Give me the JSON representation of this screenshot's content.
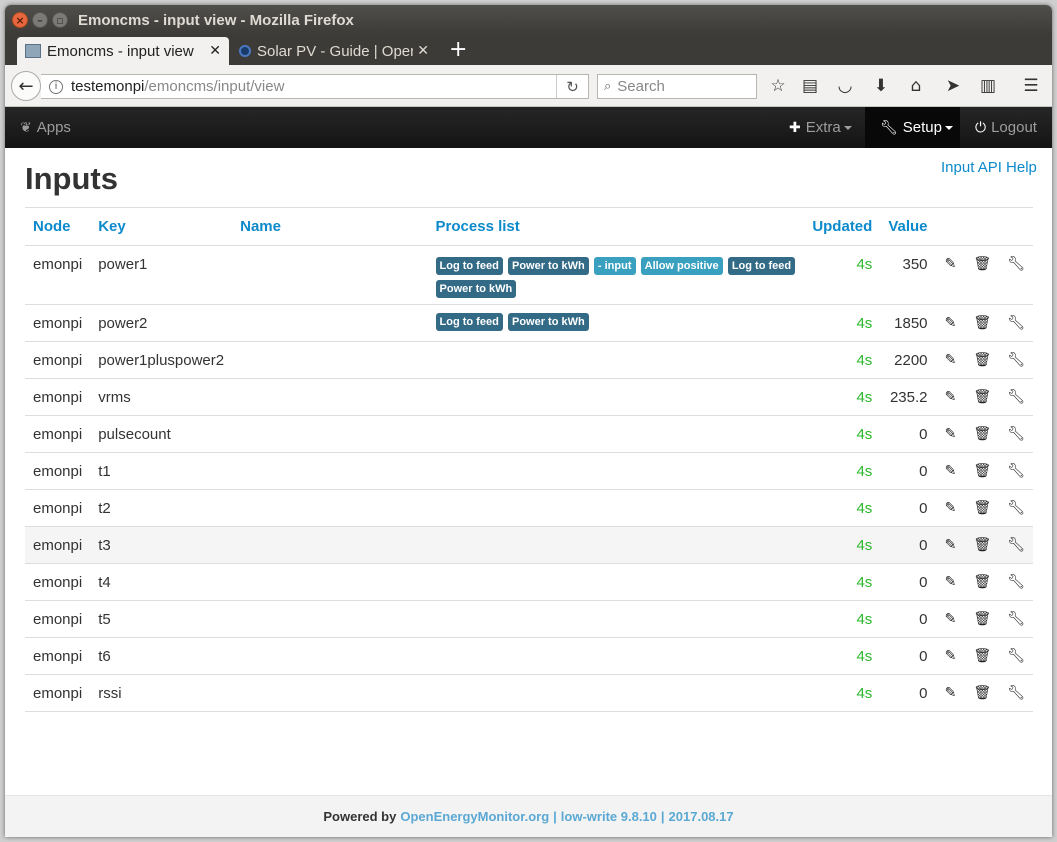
{
  "window": {
    "title": "Emoncms - input view - Mozilla Firefox"
  },
  "tabs": [
    {
      "label": "Emoncms - input view",
      "close": "✕"
    },
    {
      "label": "Solar PV - Guide | OpenEnergyMonitor",
      "close": "✕"
    }
  ],
  "toolbar": {
    "url_host": "testemonpi",
    "url_path": "/emoncms/input/view",
    "search_placeholder": "Search"
  },
  "appnav": {
    "apps": "Apps",
    "extra": "Extra",
    "setup": "Setup",
    "logout": "Logout"
  },
  "page": {
    "title": "Inputs",
    "api_help": "Input API Help"
  },
  "table": {
    "headers": {
      "node": "Node",
      "key": "Key",
      "name": "Name",
      "process": "Process list",
      "updated": "Updated",
      "value": "Value"
    },
    "rows": [
      {
        "node": "emonpi",
        "key": "power1",
        "name": "",
        "process": [
          {
            "label": "Log to feed",
            "style": "dark"
          },
          {
            "label": "Power to kWh",
            "style": "dark"
          },
          {
            "label": "- input",
            "style": "light"
          },
          {
            "label": "Allow positive",
            "style": "light"
          },
          {
            "label": "Log to feed",
            "style": "dark"
          },
          {
            "label": "Power to kWh",
            "style": "dark"
          }
        ],
        "updated": "4s",
        "value": "350"
      },
      {
        "node": "emonpi",
        "key": "power2",
        "name": "",
        "process": [
          {
            "label": "Log to feed",
            "style": "dark"
          },
          {
            "label": "Power to kWh",
            "style": "dark"
          }
        ],
        "updated": "4s",
        "value": "1850"
      },
      {
        "node": "emonpi",
        "key": "power1pluspower2",
        "name": "",
        "process": [],
        "updated": "4s",
        "value": "2200"
      },
      {
        "node": "emonpi",
        "key": "vrms",
        "name": "",
        "process": [],
        "updated": "4s",
        "value": "235.2"
      },
      {
        "node": "emonpi",
        "key": "pulsecount",
        "name": "",
        "process": [],
        "updated": "4s",
        "value": "0"
      },
      {
        "node": "emonpi",
        "key": "t1",
        "name": "",
        "process": [],
        "updated": "4s",
        "value": "0"
      },
      {
        "node": "emonpi",
        "key": "t2",
        "name": "",
        "process": [],
        "updated": "4s",
        "value": "0"
      },
      {
        "node": "emonpi",
        "key": "t3",
        "name": "",
        "process": [],
        "updated": "4s",
        "value": "0"
      },
      {
        "node": "emonpi",
        "key": "t4",
        "name": "",
        "process": [],
        "updated": "4s",
        "value": "0"
      },
      {
        "node": "emonpi",
        "key": "t5",
        "name": "",
        "process": [],
        "updated": "4s",
        "value": "0"
      },
      {
        "node": "emonpi",
        "key": "t6",
        "name": "",
        "process": [],
        "updated": "4s",
        "value": "0"
      },
      {
        "node": "emonpi",
        "key": "rssi",
        "name": "",
        "process": [],
        "updated": "4s",
        "value": "0"
      }
    ]
  },
  "footer": {
    "powered_by": "Powered by",
    "link": "OpenEnergyMonitor.org",
    "version": "low-write 9.8.10",
    "date": "2017.08.17",
    "sep": "|"
  },
  "colors": {
    "link": "#0d8acb",
    "updated": "#2db82d",
    "badge_dark": "#336b87",
    "badge_light": "#3aa0c0"
  }
}
